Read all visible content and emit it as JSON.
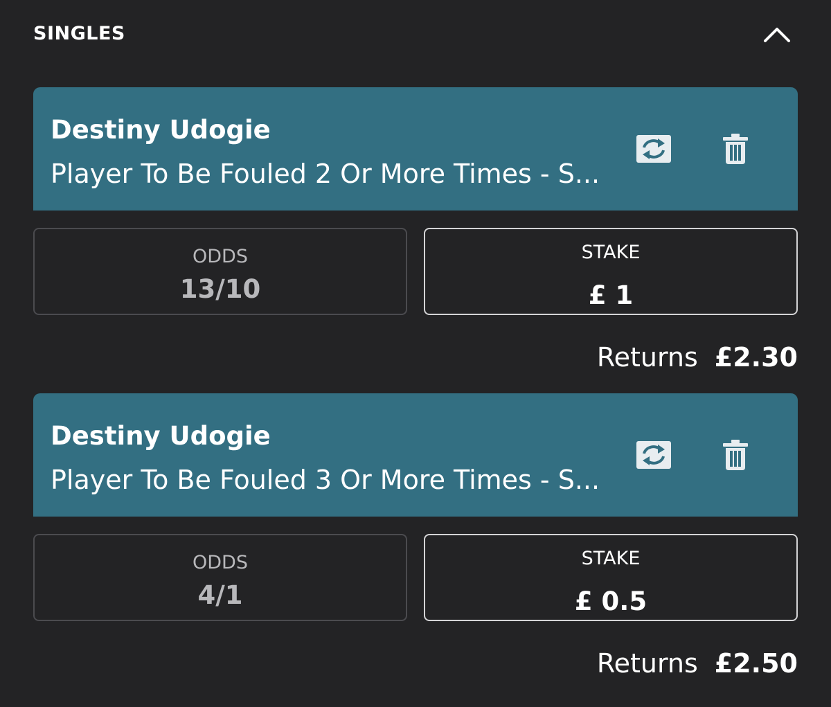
{
  "section": {
    "title": "SINGLES",
    "collapse_icon": "chevron-up-icon"
  },
  "bets": [
    {
      "player": "Destiny Udogie",
      "market": "Player To Be Fouled 2 Or More Times - S...",
      "odds_label": "ODDS",
      "odds_value": "13/10",
      "stake_label": "STAKE",
      "stake_value": "£ 1",
      "returns_label": "Returns",
      "returns_value": "£2.30"
    },
    {
      "player": "Destiny Udogie",
      "market": "Player To Be Fouled 3 Or More Times - S...",
      "odds_label": "ODDS",
      "odds_value": "4/1",
      "stake_label": "STAKE",
      "stake_value": "£ 0.5",
      "returns_label": "Returns",
      "returns_value": "£2.50"
    }
  ],
  "colors": {
    "background": "#232325",
    "bet_header": "#336f82",
    "odds_border": "#4b4b4f",
    "stake_border": "#d4d4d6",
    "muted_text": "#b8b8bb",
    "icon_fill": "#e8edf0"
  },
  "icons": {
    "swap": "swap-icon",
    "delete": "trash-icon"
  }
}
